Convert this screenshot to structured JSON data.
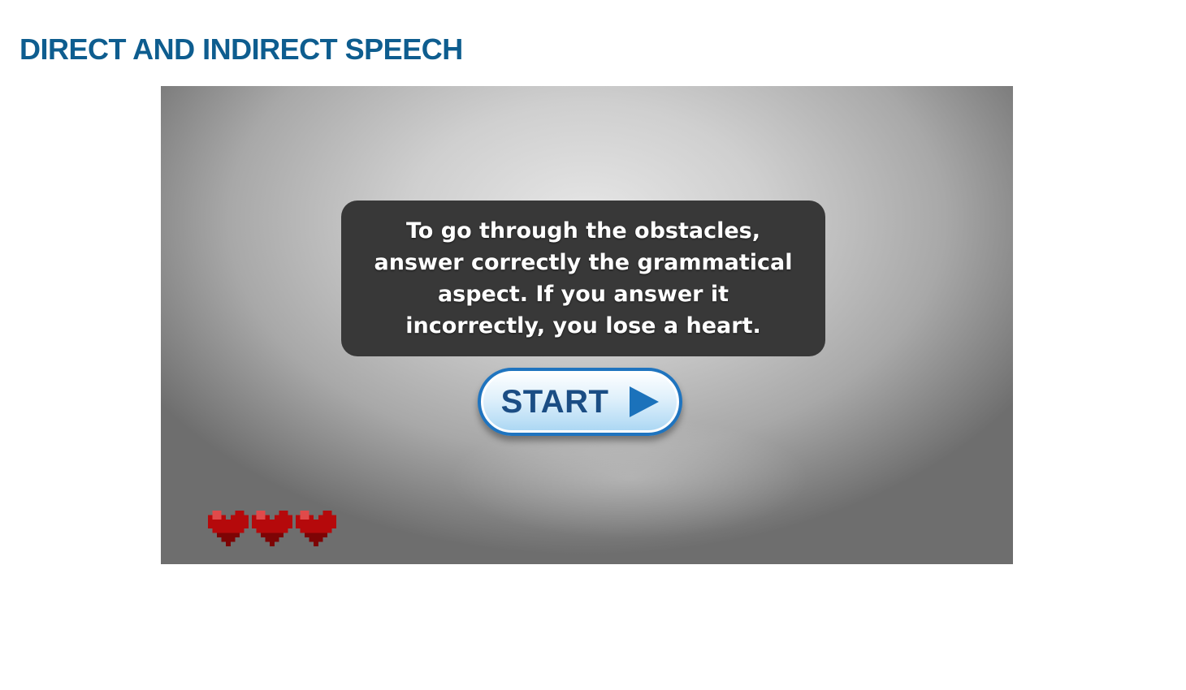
{
  "page": {
    "title": "DIRECT AND INDIRECT SPEECH"
  },
  "game": {
    "instructions": "To go through the obstacles, answer correctly the grammatical aspect. If you answer it incorrectly, you lose a heart.",
    "start_label": "START",
    "lives": 3
  },
  "icons": {
    "start": "play-triangle-icon",
    "life": "heart-icon"
  },
  "colors": {
    "title": "#0e5d8f",
    "panel_bg": "#383838",
    "button_border": "#1f74bf",
    "button_text": "#1b4d84",
    "heart": "#b5090b"
  }
}
